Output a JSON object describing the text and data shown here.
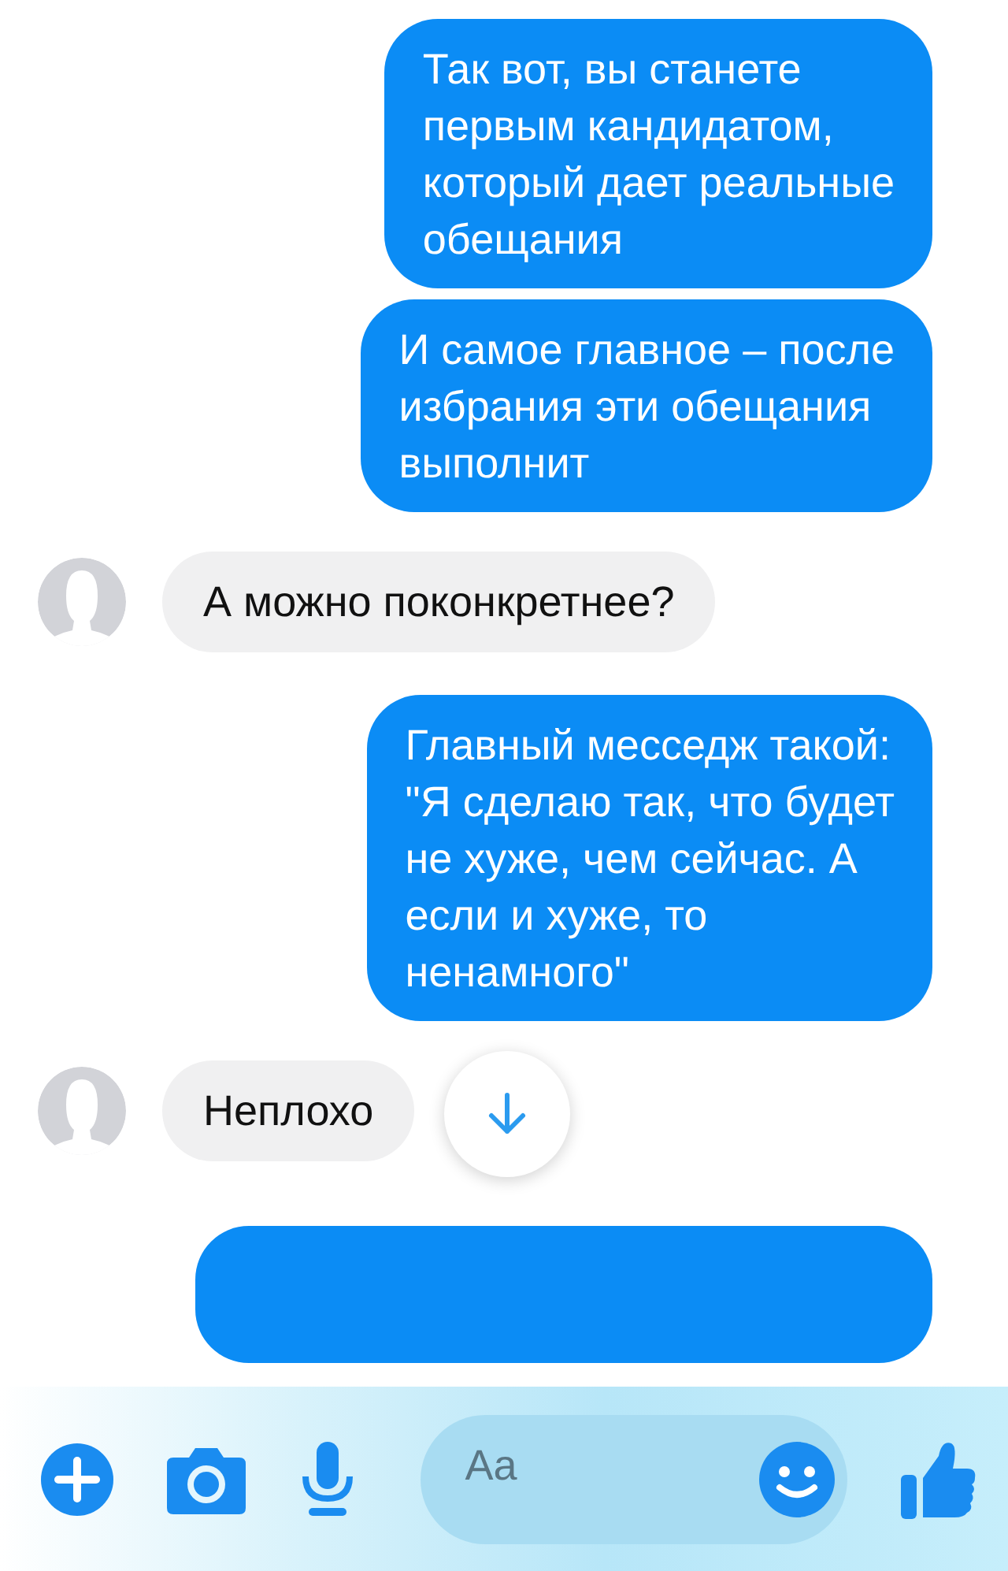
{
  "messages": [
    {
      "kind": "sent",
      "text": "Так вот, вы станете\nпервым кандидатом,\nкоторый дает реальные\nобещания"
    },
    {
      "kind": "sent",
      "text": "И самое главное – после\nизбрания эти обещания\nвыполнит"
    },
    {
      "kind": "received",
      "text": "А можно поконкретнее?"
    },
    {
      "kind": "sent",
      "text": "Главный месседж такой:\n\"Я сделаю так, что будет\nне хуже, чем сейчас. А\nесли и хуже, то\nненамного\""
    },
    {
      "kind": "received",
      "text": "Неплохо"
    },
    {
      "kind": "cut_off"
    }
  ],
  "composer": {
    "placeholder": "Aa"
  }
}
